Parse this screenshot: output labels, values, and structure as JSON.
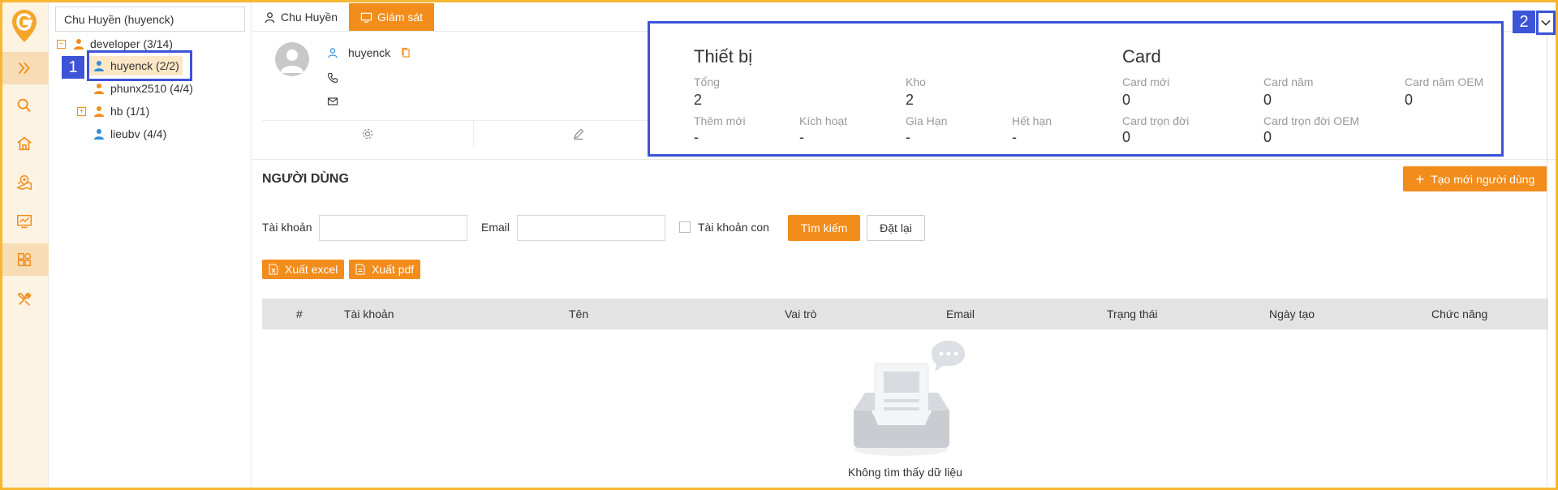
{
  "colors": {
    "accent": "#f28c1a",
    "callout": "#3d53d8",
    "frame": "#f7b733"
  },
  "rail": {
    "items": [
      {
        "name": "expand-icon"
      },
      {
        "name": "search-icon"
      },
      {
        "name": "home-icon"
      },
      {
        "name": "map-icon"
      },
      {
        "name": "monitor-chart-icon"
      },
      {
        "name": "apps-icon"
      },
      {
        "name": "tools-icon"
      }
    ]
  },
  "tree": {
    "search_value": "Chu Huyền (huyenck)",
    "nodes": [
      {
        "label": "developer (3/14)",
        "toggle": "−"
      },
      {
        "label": "huyenck (2/2)"
      },
      {
        "label": "phunx2510 (4/4)"
      },
      {
        "label": "hb (1/1)",
        "toggle": "+"
      },
      {
        "label": "lieubv (4/4)"
      }
    ]
  },
  "tabs": [
    {
      "label": "Chu Huyền"
    },
    {
      "label": "Giám sát"
    }
  ],
  "profile": {
    "username": "huyenck"
  },
  "stats": {
    "device": {
      "title": "Thiết bị",
      "items": [
        {
          "label": "Tổng",
          "value": "2"
        },
        {
          "label": "Kho",
          "value": "2"
        },
        {
          "label": "Thêm mới",
          "value": "-"
        },
        {
          "label": "Kích hoạt",
          "value": "-"
        },
        {
          "label": "Gia Hạn",
          "value": "-"
        },
        {
          "label": "Hết hạn",
          "value": "-"
        }
      ]
    },
    "card": {
      "title": "Card",
      "items": [
        {
          "label": "Card mới",
          "value": "0"
        },
        {
          "label": "Card năm",
          "value": "0"
        },
        {
          "label": "Card năm OEM",
          "value": "0"
        },
        {
          "label": "Card trọn đời",
          "value": "0"
        },
        {
          "label": "Card trọn đời OEM",
          "value": "0"
        }
      ]
    }
  },
  "users": {
    "heading": "NGƯỜI DÙNG",
    "create_label": "Tạo mới người dùng",
    "filters": {
      "account_label": "Tài khoản",
      "account_value": "",
      "email_label": "Email",
      "email_value": "",
      "child_label": "Tài khoản con",
      "child_checked": false,
      "search_label": "Tìm kiếm",
      "reset_label": "Đặt lại"
    },
    "export_excel": "Xuất excel",
    "export_pdf": "Xuất pdf",
    "columns": [
      "#",
      "Tài khoản",
      "Tên",
      "Vai trò",
      "Email",
      "Trạng thái",
      "Ngày tạo",
      "Chức năng"
    ],
    "rows": [],
    "empty_text": "Không tìm thấy dữ liệu"
  },
  "callouts": {
    "one": "1",
    "two": "2"
  }
}
